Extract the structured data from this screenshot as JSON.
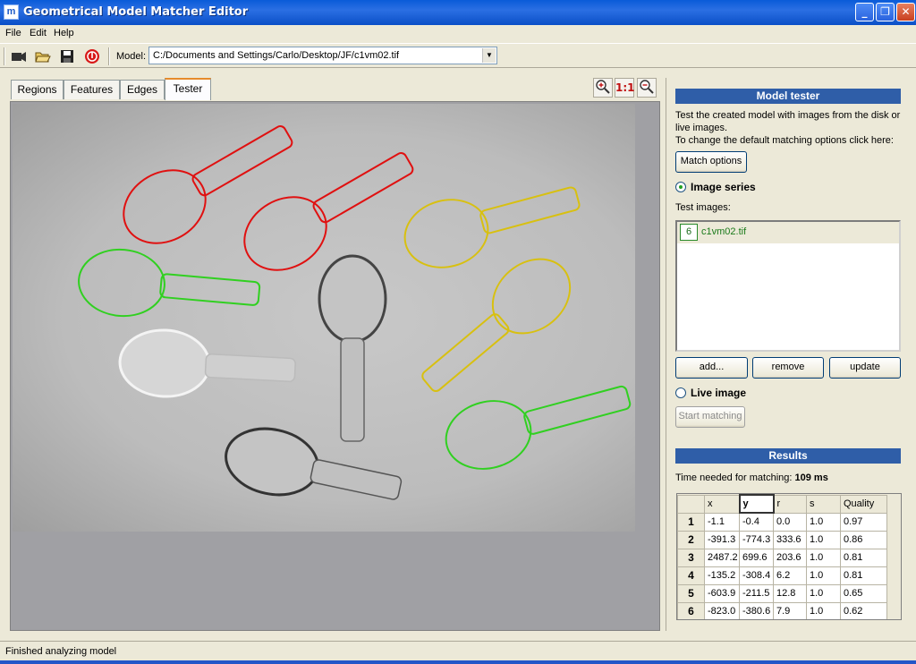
{
  "window": {
    "title": "Geometrical Model Matcher Editor",
    "app_icon": "m"
  },
  "menu": {
    "file": "File",
    "edit": "Edit",
    "help": "Help"
  },
  "toolbar": {
    "model_label": "Model:",
    "model_path": "C:/Documents and Settings/Carlo/Desktop/JF/c1vm02.tif",
    "icons": [
      "camera-icon",
      "open-folder-icon",
      "save-icon",
      "stop-icon"
    ]
  },
  "tabs": [
    {
      "label": "Regions"
    },
    {
      "label": "Features"
    },
    {
      "label": "Edges"
    },
    {
      "label": "Tester"
    }
  ],
  "zoom": {
    "zoom_in": "⊕",
    "actual_size": "1:1",
    "zoom_out": "⊖"
  },
  "tester": {
    "header": "Model tester",
    "desc_line1": "Test the created model with images from the disk or live images.",
    "desc_line2": "To change the default matching options click here:",
    "match_options": "Match options",
    "image_series": "Image series",
    "test_images_label": "Test images:",
    "test_images": [
      {
        "num": "6",
        "name": "c1vm02.tif"
      }
    ],
    "add": "add...",
    "remove": "remove",
    "update": "update",
    "live_image": "Live image",
    "start_matching": "Start matching"
  },
  "results": {
    "header": "Results",
    "time_label": "Time needed for matching:",
    "time_value": "109 ms",
    "columns": [
      "x",
      "y",
      "r",
      "s",
      "Quality"
    ],
    "rows": [
      {
        "id": "1",
        "x": "-1.1",
        "y": "-0.4",
        "r": "0.0",
        "s": "1.0",
        "q": "0.97"
      },
      {
        "id": "2",
        "x": "-391.3",
        "y": "-774.3",
        "r": "333.6",
        "s": "1.0",
        "q": "0.86"
      },
      {
        "id": "3",
        "x": "2487.2",
        "y": "699.6",
        "r": "203.6",
        "s": "1.0",
        "q": "0.81"
      },
      {
        "id": "4",
        "x": "-135.2",
        "y": "-308.4",
        "r": "6.2",
        "s": "1.0",
        "q": "0.81"
      },
      {
        "id": "5",
        "x": "-603.9",
        "y": "-211.5",
        "r": "12.8",
        "s": "1.0",
        "q": "0.65"
      },
      {
        "id": "6",
        "x": "-823.0",
        "y": "-380.6",
        "r": "7.9",
        "s": "1.0",
        "q": "0.62"
      }
    ]
  },
  "status": {
    "text": "Finished analyzing model"
  },
  "colors": {
    "match_red": "#e01010",
    "match_green": "#30d020",
    "match_yellow": "#d8c010",
    "header_blue": "#2f5ea8"
  }
}
